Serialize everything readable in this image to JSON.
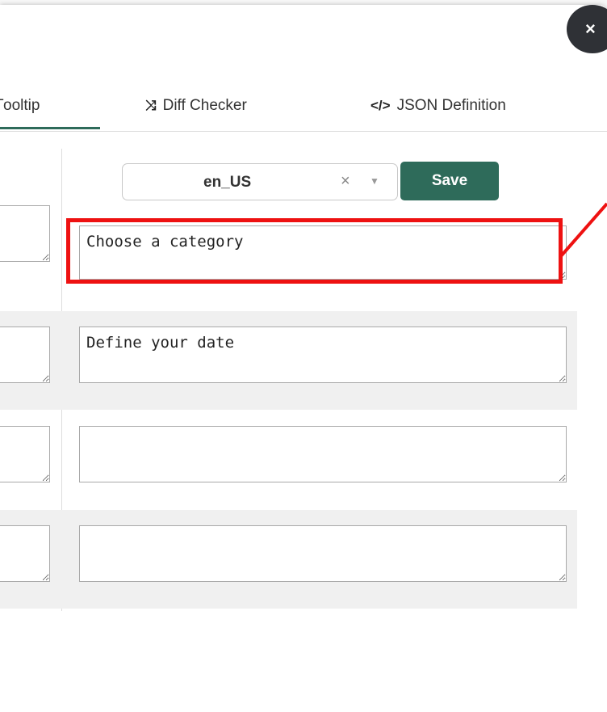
{
  "tabs": [
    {
      "label": "ooltip",
      "clip": "T",
      "active": true
    },
    {
      "label": "Diff Checker",
      "icon": "shuffle-icon",
      "glyph": "⤨"
    },
    {
      "label": "JSON Definition",
      "icon": "code-icon",
      "glyph": "</>"
    }
  ],
  "toolbar": {
    "locale": "en_US",
    "clear_glyph": "×",
    "caret_glyph": "▼",
    "save_label": "Save"
  },
  "close_glyph": "×",
  "rows": [
    {
      "left_value": "",
      "right_value": "Choose a category"
    },
    {
      "left_value": "",
      "right_value": "Define your date"
    },
    {
      "left_value": "",
      "right_value": ""
    },
    {
      "left_value": "",
      "right_value": ""
    }
  ],
  "colors": {
    "accent": "#2e6b5a",
    "highlight": "#ee1111",
    "row_alt": "#f0f0f0"
  }
}
